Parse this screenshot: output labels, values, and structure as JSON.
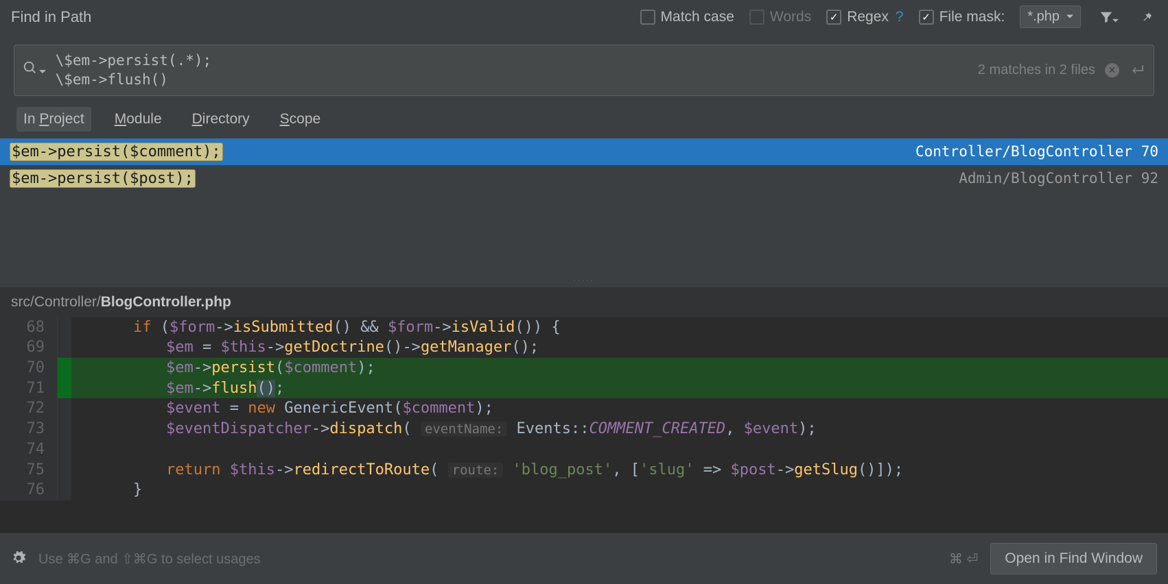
{
  "title": "Find in Path",
  "options": {
    "match_case": {
      "label": "Match case",
      "checked": false
    },
    "words": {
      "label": "Words",
      "checked": false,
      "disabled": true
    },
    "regex": {
      "label": "Regex",
      "checked": true
    },
    "file_mask": {
      "label": "File mask:",
      "checked": true,
      "value": "*.php"
    }
  },
  "search": {
    "query": "\\$em->persist(.*);\n\\$em->flush()",
    "match_info": "2 matches in 2 files"
  },
  "tabs": {
    "items": [
      "In Project",
      "Module",
      "Directory",
      "Scope"
    ],
    "active": 0
  },
  "results": [
    {
      "code": "$em->persist($comment);",
      "location": "Controller/BlogController 70",
      "selected": true
    },
    {
      "code": "$em->persist($post);",
      "location": "Admin/BlogController 92",
      "selected": false
    }
  ],
  "preview": {
    "path_prefix": "src/Controller/",
    "filename": "BlogController.php",
    "lines": [
      {
        "num": 68,
        "html": "<span class='kw'>if</span> (<span class='var'>$form</span><span class='op'>-></span><span class='fn'>isSubmitted</span>() <span class='op'>&&</span> <span class='var'>$form</span><span class='op'>-></span><span class='fn'>isValid</span>()) {",
        "match": false,
        "indent": 0
      },
      {
        "num": 69,
        "html": "<span class='var'>$em</span> <span class='op'>=</span> <span class='var'>$this</span><span class='op'>-></span><span class='fn'>getDoctrine</span>()<span class='op'>-></span><span class='fn'>getManager</span>()<span class='punc'>;</span>",
        "match": false,
        "indent": 1
      },
      {
        "num": 70,
        "html": "<span class='var'>$em</span><span class='op'>-></span><span class='fn'>persist</span>(<span class='var'>$comment</span>)<span class='punc'>;</span>",
        "match": true,
        "indent": 1
      },
      {
        "num": 71,
        "html": "<span class='var'>$em</span><span class='op'>-></span><span class='fn'>flush</span><span class='paren-y'>()</span><span class='punc'>;</span>",
        "match": true,
        "indent": 1
      },
      {
        "num": 72,
        "html": "<span class='var'>$event</span> <span class='op'>=</span> <span class='kw'>new</span> <span class='fn' style='color:#a9b7c6'>GenericEvent</span>(<span class='var'>$comment</span>)<span class='punc'>;</span>",
        "match": false,
        "indent": 1
      },
      {
        "num": 73,
        "html": "<span class='var'>$eventDispatcher</span><span class='op'>-></span><span class='fn'>dispatch</span>( <span class='hint'>eventName:</span> Events<span class='op'>::</span><span class='const'>COMMENT_CREATED</span><span class='punc'>,</span> <span class='var'>$event</span>)<span class='punc'>;</span>",
        "match": false,
        "indent": 1
      },
      {
        "num": 74,
        "html": "",
        "match": false,
        "indent": 1
      },
      {
        "num": 75,
        "html": "<span class='kw'>return</span> <span class='var'>$this</span><span class='op'>-></span><span class='fn'>redirectToRoute</span>( <span class='hint'>route:</span> <span class='str'>'blog_post'</span><span class='punc'>,</span> [<span class='str'>'slug'</span> <span class='op'>=></span> <span class='var'>$post</span><span class='op'>-></span><span class='fn'>getSlug</span>()])<span class='punc'>;</span>",
        "match": false,
        "indent": 1
      },
      {
        "num": 76,
        "html": "}",
        "match": false,
        "indent": 0
      }
    ]
  },
  "footer": {
    "hint": "Use ⌘G and ⇧⌘G to select usages",
    "shortcut": "⌘ ⏎",
    "button": "Open in Find Window"
  }
}
